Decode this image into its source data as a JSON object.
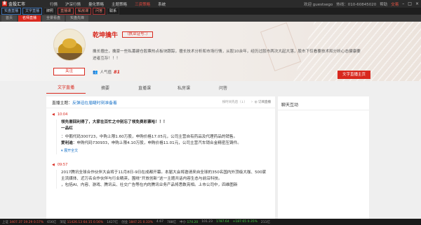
{
  "app": {
    "logo_text": "金投汇市",
    "menu": [
      "行情",
      "沪深行情",
      "量化策略",
      "主题策略",
      "三资策略",
      "系统"
    ],
    "welcome": "欢迎 guestsego",
    "hotline": "热线：010-60845020",
    "help": "帮助",
    "exchange": "交易"
  },
  "toolbar": [
    "实盘直播",
    "文字直播",
    "牌照",
    "直播课",
    "私房课",
    "问答",
    "联系"
  ],
  "tabs_top": [
    "首页",
    "名师直播",
    "全景看盘",
    "实盘先锋"
  ],
  "profile": {
    "name": "乾坤擒牛",
    "cert": "（执业证号：）",
    "bio": "擒长擅庄，擒豪一些私募建仓股票热点板块跟踪，擅长技术分析和市场行情，从股10余年，经历过股市两次大起大落，股市下仅看要技术和分析心态健康要进者互存！！！",
    "follow": "关注",
    "popularity_label": "人气值",
    "popularity_value": "81",
    "home_button": "文字直播主页"
  },
  "tabs": [
    "文字直播",
    "摘要",
    "直播课",
    "私房课",
    "问答"
  ],
  "live": {
    "topic_label": "直播主题：",
    "topic": "反弹迫在眉睫时刻准备着",
    "sort": "按时间先后（↓）",
    "subscribe": "◎ 订阅直播"
  },
  "sidebar": {
    "title": "聊天互动"
  },
  "posts": [
    {
      "time": "10:04",
      "title": "领先套回利得了，大家在百忙之中别忘了领免费彩票哈！！！",
      "subtitle": "一品红",
      "line1": "：中鹅代码300723，中购上限1.60万股，申购价格17.05元，公司主营自有药品及代理药品的销售。",
      "line2_label": "爱利迪",
      "line2": "：申购代码730933，申购上限4.10万股，申购价格11.01元，公司主营汽车销合金精密压铸件。",
      "expand": "展开全文"
    },
    {
      "time": "09:57",
      "line1": "2017腾讯全球合作伙伴大会将于11月8日-9日在成都开幕。本届大会将邀请来自全球的350名国内外顶级大咖、500家主流媒体、近万名合作伙伴与行业精英，围绕“开放创新”这一主题共话内容生态与前沿科技。",
      "line2": "，包括AI、内容、游戏、腾讯云、社交广告等在内的腾讯业务产品将悉数亮相。上市公司中，四维图新"
    }
  ],
  "status": {
    "items": [
      {
        "label": "上证",
        "value": "3407.37",
        "change": "19.29",
        "pct": "0.57%",
        "dir": "up"
      },
      {
        "label": "",
        "value": "656亿",
        "change": "",
        "pct": "",
        "dir": "none"
      },
      {
        "label": "深证",
        "value": "11426.13",
        "change": "64.15",
        "pct": "0.56%",
        "dir": "up"
      },
      {
        "label": "",
        "value": "1427亿",
        "change": "",
        "pct": "",
        "dir": "none"
      },
      {
        "label": "创业",
        "value": "1847.21",
        "change": "",
        "pct": "0.33%",
        "dir": "up"
      },
      {
        "label": "",
        "value": "4.67",
        "change": "",
        "pct": "",
        "dir": "none"
      },
      {
        "label": "",
        "value": "788亿",
        "change": "",
        "pct": "",
        "dir": "none"
      },
      {
        "label": "中小",
        "value": "174.20",
        "change": "",
        "pct": "",
        "dir": "dn"
      },
      {
        "label": "",
        "value": "101.23",
        "change": "",
        "pct": "",
        "dir": "none"
      },
      {
        "label": "",
        "value": "1787.64",
        "change": "",
        "pct": "",
        "dir": "none"
      },
      {
        "label": "",
        "value": "+187.65",
        "change": "",
        "pct": "0.35%",
        "dir": "dn"
      },
      {
        "label": "",
        "value": "211亿",
        "change": "",
        "pct": "",
        "dir": "none"
      }
    ]
  }
}
